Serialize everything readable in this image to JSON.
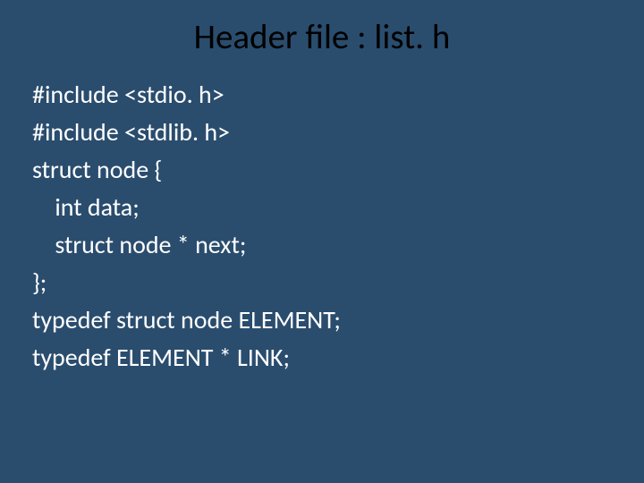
{
  "title": "Header file : list. h",
  "code": {
    "lines": [
      "#include <stdio. h>",
      "#include <stdlib. h>",
      "struct node {",
      "    int data;",
      "    struct node * next;",
      "};",
      "typedef struct node ELEMENT;",
      "typedef ELEMENT * LINK;"
    ]
  }
}
